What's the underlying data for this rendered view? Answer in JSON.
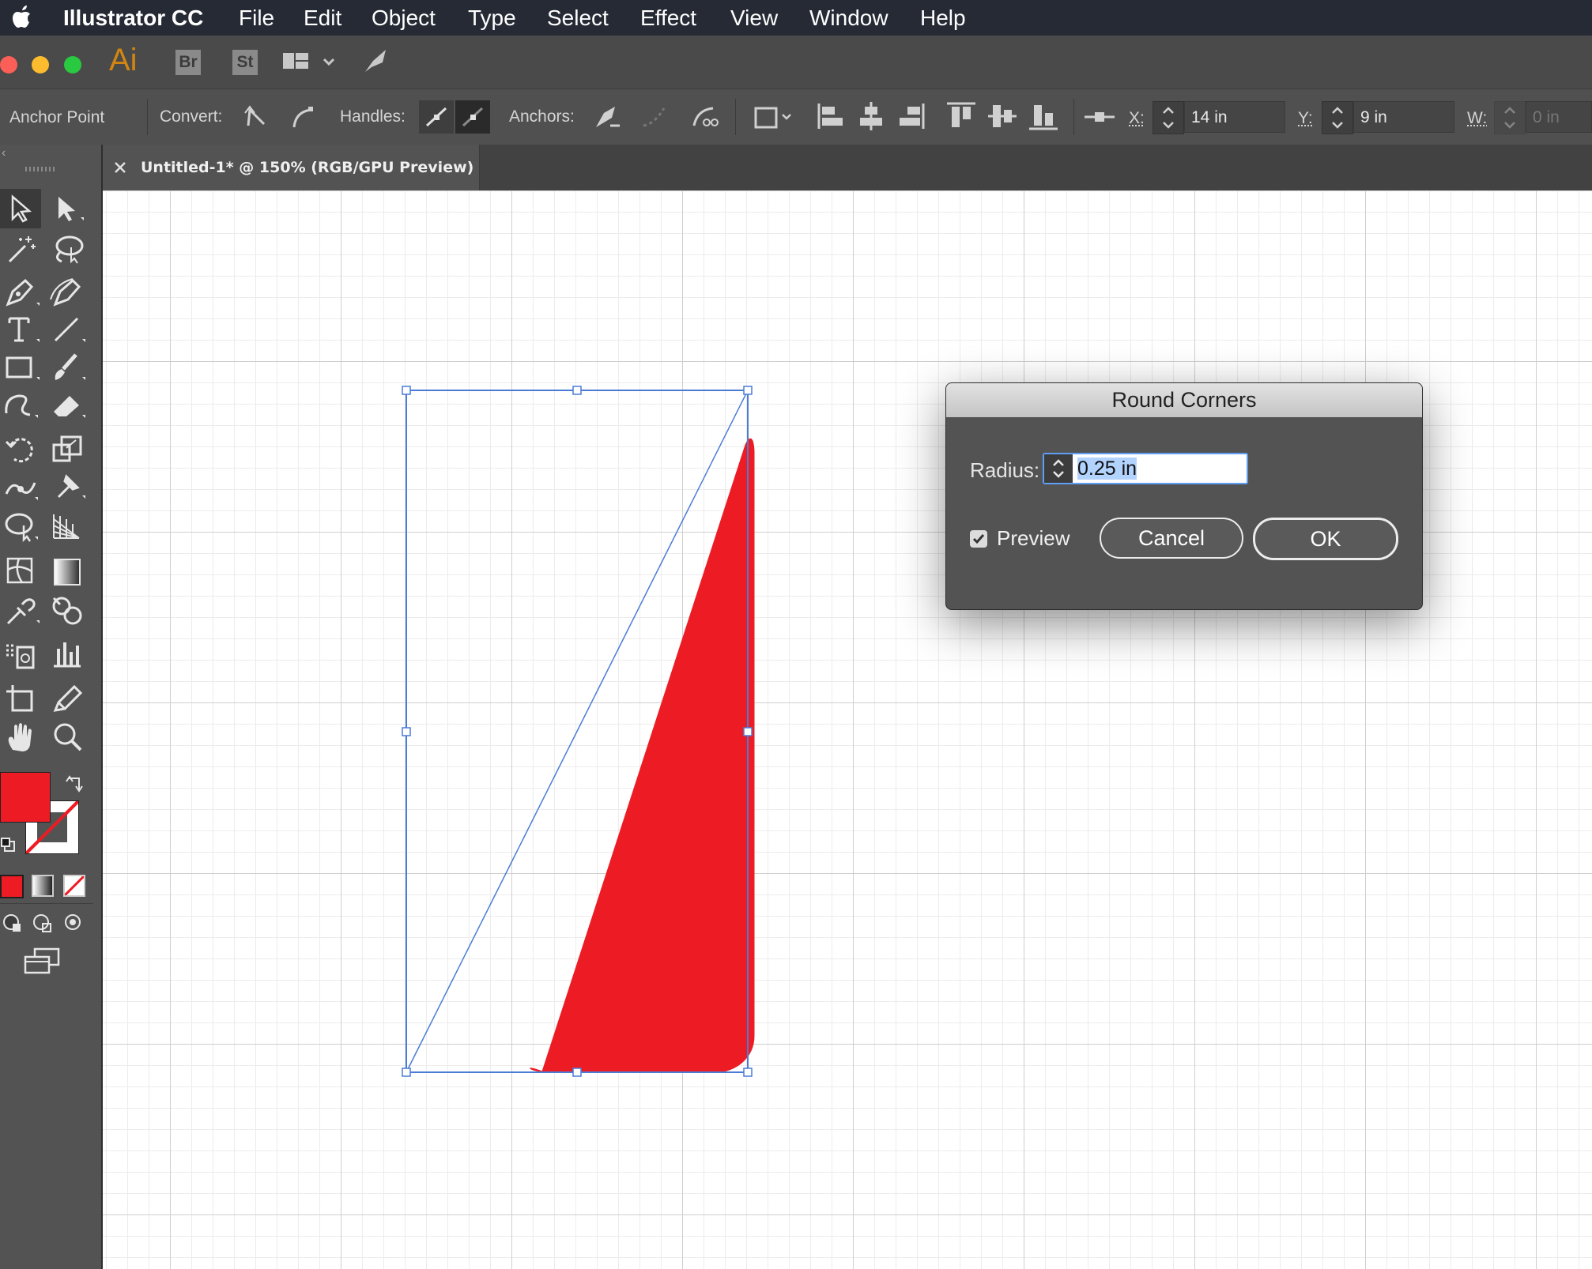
{
  "menubar": {
    "app_name": "Illustrator CC",
    "items": [
      "File",
      "Edit",
      "Object",
      "Type",
      "Select",
      "Effect",
      "View",
      "Window",
      "Help"
    ]
  },
  "appbar": {
    "ai_label": "Ai",
    "bridge_label": "Br",
    "stock_label": "St"
  },
  "control_bar": {
    "context_label": "Anchor Point",
    "convert_label": "Convert:",
    "handles_label": "Handles:",
    "anchors_label": "Anchors:",
    "x_label": "X:",
    "x_value": "14 in",
    "y_label": "Y:",
    "y_value": "9 in",
    "w_label": "W:",
    "w_value": "0 in"
  },
  "document": {
    "tab_title": "Untitled-1* @ 150% (RGB/GPU Preview)"
  },
  "colors": {
    "fill": "#ed1c24",
    "selection": "#4a7cd6",
    "dialog_highlight": "#b3d3ff"
  },
  "dialog": {
    "title": "Round Corners",
    "radius_label": "Radius:",
    "radius_value": "0.25 in",
    "preview_label": "Preview",
    "preview_checked": true,
    "cancel_label": "Cancel",
    "ok_label": "OK"
  }
}
